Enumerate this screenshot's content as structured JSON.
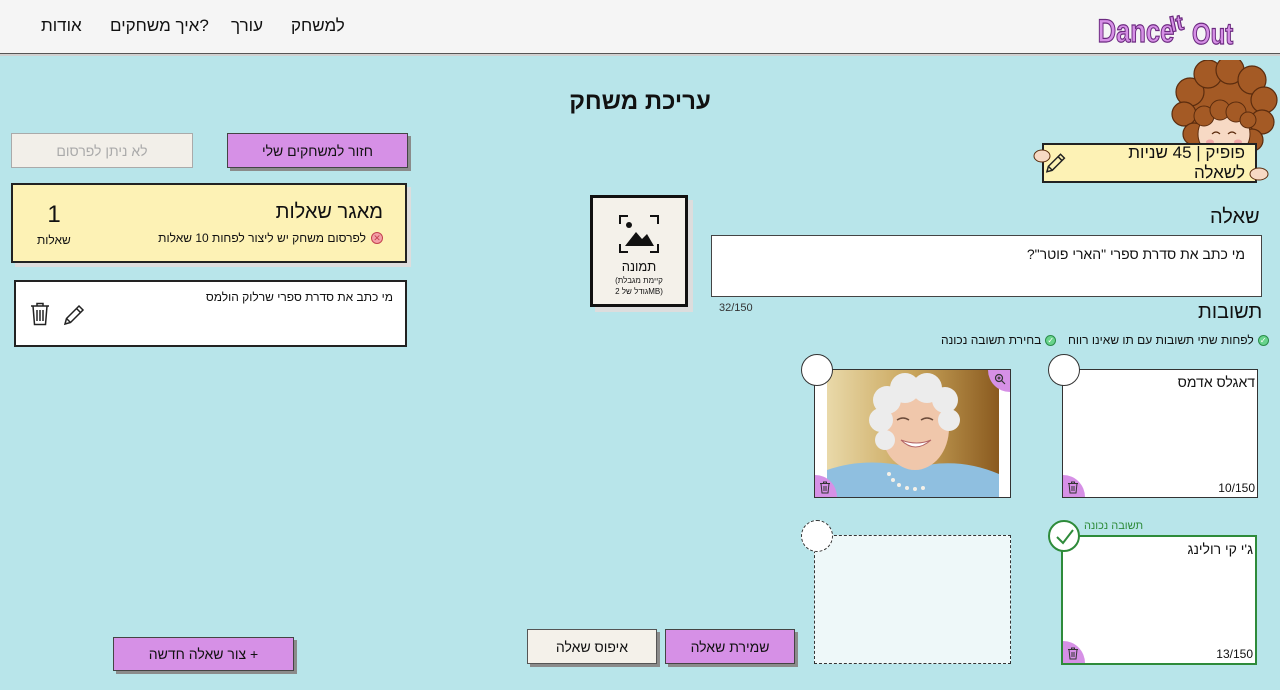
{
  "nav": {
    "play": "למשחק",
    "editor": "עורך",
    "how_to": "איך משחקים?",
    "about": "אודות"
  },
  "logo": {
    "text": "Dance It Out"
  },
  "page_title": "עריכת משחק",
  "left": {
    "cannot_publish": "לא ניתן לפרסום",
    "back_to_games": "חזור למשחקים שלי",
    "bank_title": "מאגר שאלות",
    "bank_warning": "לפרסום משחק יש ליצור לפחות 10 שאלות",
    "bank_count": "1",
    "bank_count_label": "שאלות",
    "question_item": "מי כתב את סדרת ספרי שרלוק הולמס",
    "new_question": "צור שאלה חדשה +"
  },
  "editor": {
    "timer_label": "פופיק | 45 שניות לשאלה",
    "question_label": "שאלה",
    "question_text": "מי כתב את סדרת ספרי \"הארי פוטר\"?",
    "question_counter": "32/150",
    "image_label": "תמונה",
    "image_hint_1": "(קיימת מגבלת",
    "image_hint_2": "גודל של 2MB)",
    "answers_label": "תשובות",
    "req_two_answers": "לפחות שתי תשובות עם תו שאינו רווח",
    "req_correct": "בחירת תשובה נכונה",
    "correct_answer_tag": "תשובה נכונה",
    "answers": [
      {
        "text": "דאגלס אדמס",
        "counter": "10/150"
      },
      {
        "text": "ג'י קי רולינג",
        "counter": "13/150"
      }
    ],
    "save_question": "שמירת שאלה",
    "reset_question": "איפוס שאלה"
  },
  "colors": {
    "background": "#b8e5ea",
    "accent_purple": "#d690e6",
    "cream": "#fdf2b5",
    "correct_green": "#2e8b3a"
  }
}
